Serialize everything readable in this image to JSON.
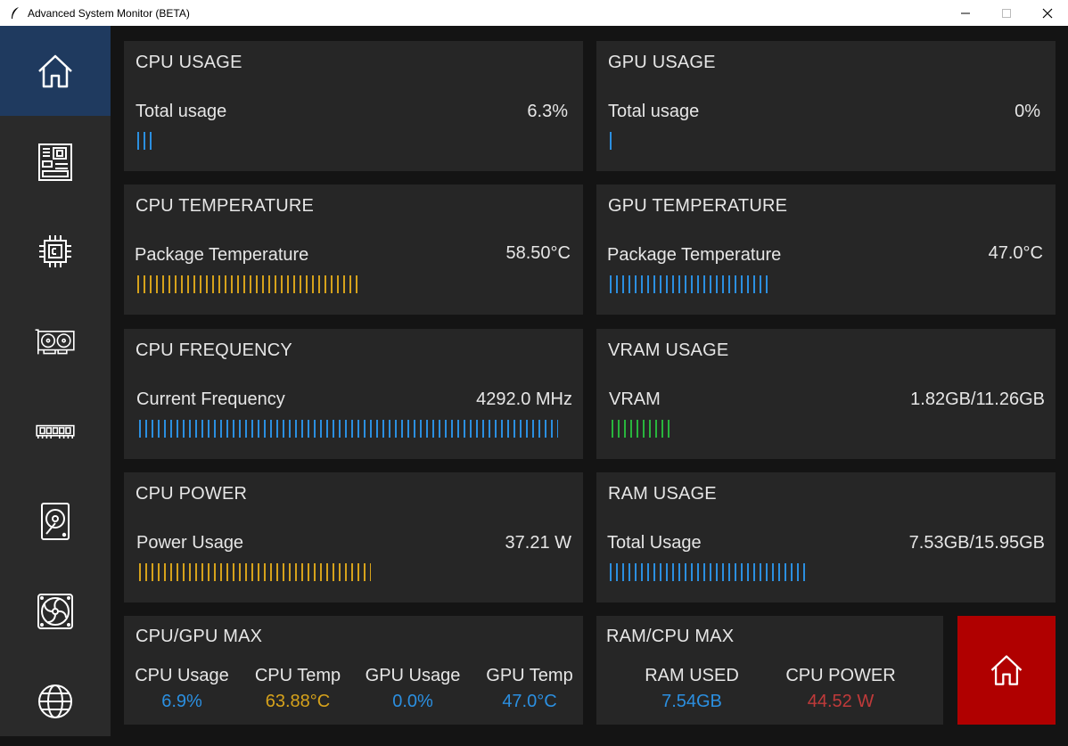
{
  "window": {
    "title": "Advanced System Monitor (BETA)"
  },
  "sidebar": {
    "items": [
      {
        "icon": "home-icon",
        "active": true
      },
      {
        "icon": "motherboard-icon",
        "active": false
      },
      {
        "icon": "cpu-chip-icon",
        "active": false
      },
      {
        "icon": "graphics-card-icon",
        "active": false
      },
      {
        "icon": "ram-icon",
        "active": false
      },
      {
        "icon": "hard-drive-icon",
        "active": false
      },
      {
        "icon": "fan-icon",
        "active": false
      },
      {
        "icon": "network-globe-icon",
        "active": false
      }
    ]
  },
  "panels": {
    "cpu_usage": {
      "title": "CPU USAGE",
      "label": "Total usage",
      "value": "6.3%",
      "level": 0.063
    },
    "gpu_usage": {
      "title": "GPU USAGE",
      "label": "Total usage",
      "value": "0%",
      "level": 0.0
    },
    "cpu_temp": {
      "title": "CPU TEMPERATURE",
      "label": "Package Temperature",
      "value": "58.50°C",
      "level": 0.585
    },
    "gpu_temp": {
      "title": "GPU TEMPERATURE",
      "label": "Package Temperature",
      "value": "47.0°C",
      "level": 0.47
    },
    "cpu_freq": {
      "title": "CPU FREQUENCY",
      "label": "Current Frequency",
      "value": "4292.0 MHz",
      "level": 0.92
    },
    "vram_usage": {
      "title": "VRAM USAGE",
      "label": "VRAM",
      "value": "1.82GB/11.26GB",
      "level": 0.16
    },
    "cpu_power": {
      "title": "CPU POWER",
      "label": "Power Usage",
      "value": "37.21 W",
      "level": 0.53
    },
    "ram_usage": {
      "title": "RAM USAGE",
      "label": "Total Usage",
      "value": "7.53GB/15.95GB",
      "level": 0.47
    }
  },
  "cpu_gpu_max": {
    "title": "CPU/GPU MAX",
    "stats": [
      {
        "label": "CPU Usage",
        "value": "6.9%",
        "color": "#2b8fe0"
      },
      {
        "label": "CPU Temp",
        "value": "63.88°C",
        "color": "#d6a21b"
      },
      {
        "label": "GPU Usage",
        "value": "0.0%",
        "color": "#2b8fe0"
      },
      {
        "label": "GPU Temp",
        "value": "47.0°C",
        "color": "#2b8fe0"
      }
    ]
  },
  "ram_cpu_max": {
    "title": "RAM/CPU MAX",
    "stats": [
      {
        "label": "RAM USED",
        "value": "7.54GB",
        "color": "#2b8fe0"
      },
      {
        "label": "CPU POWER",
        "value": "44.52 W",
        "color": "#c03a3a"
      }
    ]
  },
  "colors": {
    "accent_blue": "#2b8fe0",
    "accent_yellow": "#d6a21b",
    "accent_green": "#29b53d",
    "sidebar_active": "#1f3a5f",
    "home_button": "#b00000"
  }
}
